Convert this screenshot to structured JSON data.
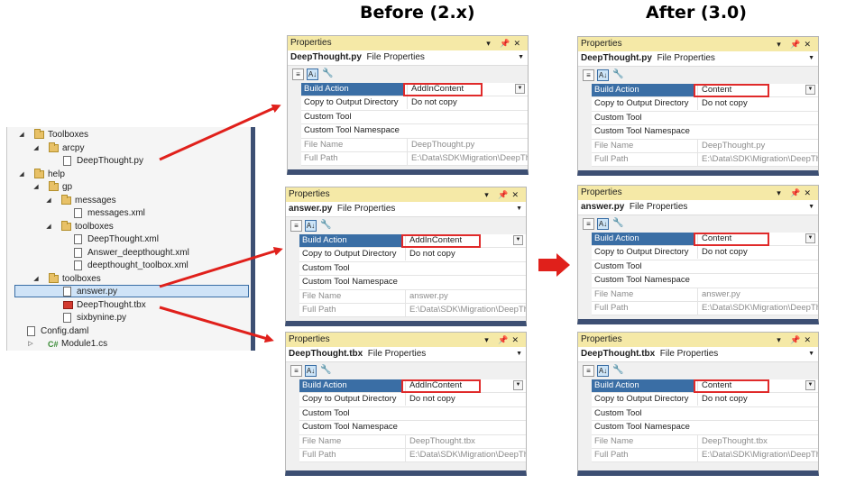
{
  "headings": {
    "before": "Before (2.x)",
    "after": "After (3.0)"
  },
  "tree": {
    "items": [
      {
        "label": "Toolboxes",
        "type": "folder",
        "expanded": true
      },
      {
        "label": "arcpy",
        "type": "folder",
        "expanded": true
      },
      {
        "label": "DeepThought.py",
        "type": "file"
      },
      {
        "label": "help",
        "type": "folder",
        "expanded": true
      },
      {
        "label": "gp",
        "type": "folder",
        "expanded": true
      },
      {
        "label": "messages",
        "type": "folder",
        "expanded": true
      },
      {
        "label": "messages.xml",
        "type": "file"
      },
      {
        "label": "toolboxes",
        "type": "folder",
        "expanded": true
      },
      {
        "label": "DeepThought.xml",
        "type": "file"
      },
      {
        "label": "Answer_deepthought.xml",
        "type": "file"
      },
      {
        "label": "deepthought_toolbox.xml",
        "type": "file"
      },
      {
        "label": "toolboxes",
        "type": "folder",
        "expanded": true
      },
      {
        "label": "answer.py",
        "type": "file",
        "selected": true
      },
      {
        "label": "DeepThought.tbx",
        "type": "tbx"
      },
      {
        "label": "sixbynine.py",
        "type": "file"
      },
      {
        "label": "Config.daml",
        "type": "file"
      },
      {
        "label": "Module1.cs",
        "type": "cs",
        "prefix": "C#"
      }
    ]
  },
  "panel_common": {
    "title": "Properties",
    "subtitle": "File Properties",
    "prop_names": [
      "Build Action",
      "Copy to Output Directory",
      "Custom Tool",
      "Custom Tool Namespace",
      "File Name",
      "Full Path"
    ]
  },
  "panels": [
    {
      "file": "DeepThought.py",
      "build_action": "AddInContent",
      "copy": "Do not copy",
      "file_name": "DeepThought.py",
      "full_path": "E:\\Data\\SDK\\Migration\\DeepThou"
    },
    {
      "file": "answer.py",
      "build_action": "AddInContent",
      "copy": "Do not copy",
      "file_name": "answer.py",
      "full_path": "E:\\Data\\SDK\\Migration\\DeepThou"
    },
    {
      "file": "DeepThought.tbx",
      "build_action": "AddInContent",
      "copy": "Do not copy",
      "file_name": "DeepThought.tbx",
      "full_path": "E:\\Data\\SDK\\Migration\\DeepThou"
    },
    {
      "file": "DeepThought.py",
      "build_action": "Content",
      "copy": "Do not copy",
      "file_name": "DeepThought.py",
      "full_path": "E:\\Data\\SDK\\Migration\\DeepThou"
    },
    {
      "file": "answer.py",
      "build_action": "Content",
      "copy": "Do not copy",
      "file_name": "answer.py",
      "full_path": "E:\\Data\\SDK\\Migration\\DeepThou"
    },
    {
      "file": "DeepThought.tbx",
      "build_action": "Content",
      "copy": "Do not copy",
      "file_name": "DeepThought.tbx",
      "full_path": "E:\\Data\\SDK\\Migration\\DeepThou"
    }
  ],
  "colors": {
    "arrow": "#e0201b",
    "highlight_box": "#e02a2a",
    "title_bar": "#f5e9a7",
    "frame": "#3d4f73",
    "selection": "#3a6ea5"
  }
}
